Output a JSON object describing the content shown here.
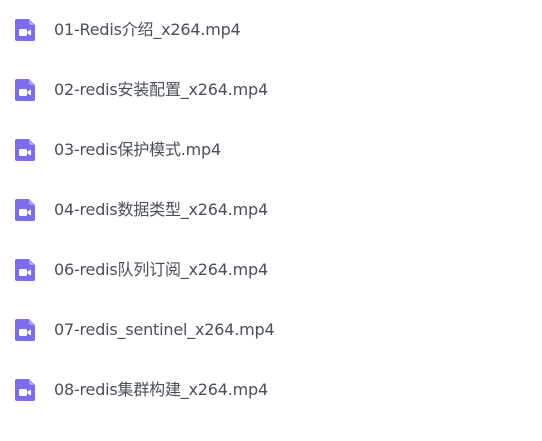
{
  "files": [
    {
      "name": "01-Redis介绍_x264.mp4",
      "icon": "video-file-icon"
    },
    {
      "name": "02-redis安装配置_x264.mp4",
      "icon": "video-file-icon"
    },
    {
      "name": "03-redis保护模式.mp4",
      "icon": "video-file-icon"
    },
    {
      "name": "04-redis数据类型_x264.mp4",
      "icon": "video-file-icon"
    },
    {
      "name": "06-redis队列订阅_x264.mp4",
      "icon": "video-file-icon"
    },
    {
      "name": "07-redis_sentinel_x264.mp4",
      "icon": "video-file-icon"
    },
    {
      "name": "08-redis集群构建_x264.mp4",
      "icon": "video-file-icon"
    }
  ],
  "colors": {
    "icon_bg": "#7b6cf0",
    "icon_glyph": "#ffffff",
    "text": "#4a4f5a",
    "background": "#ffffff"
  }
}
